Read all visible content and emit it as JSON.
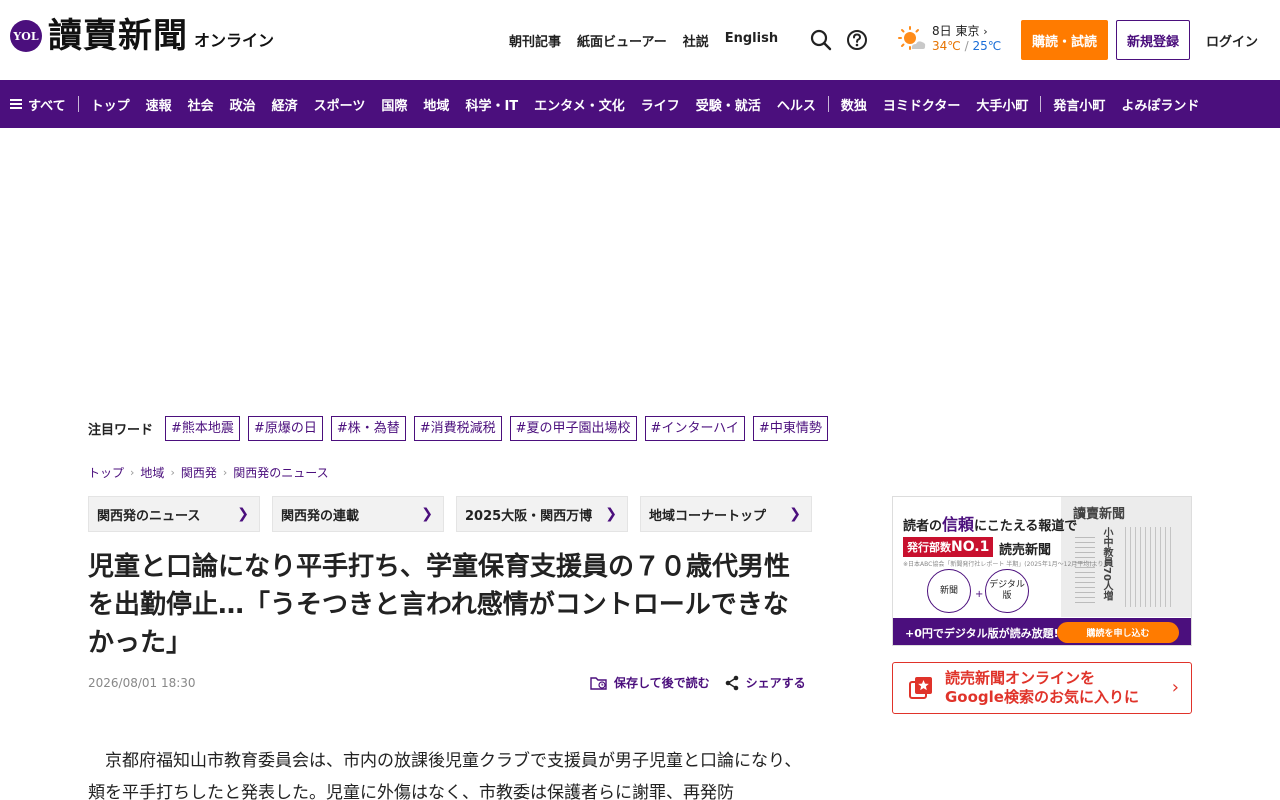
{
  "header": {
    "logo_badge": "YOL",
    "logo_text": "讀賣新聞",
    "logo_sub": "オンライン",
    "links": [
      "朝刊記事",
      "紙面ビューアー",
      "社説",
      "English"
    ],
    "weather": {
      "date_city": "8日 東京",
      "high": "34℃",
      "sep": "/",
      "low": "25℃"
    },
    "subscribe_label": "購読・試読",
    "register_label": "新規登録",
    "login_label": "ログイン"
  },
  "nav": {
    "all_label": "すべて",
    "group1": [
      "トップ",
      "速報",
      "社会",
      "政治",
      "経済",
      "スポーツ",
      "国際",
      "地域",
      "科学・IT",
      "エンタメ・文化",
      "ライフ",
      "受験・就活",
      "ヘルス"
    ],
    "group2": [
      "数独",
      "ヨミドクター",
      "大手小町"
    ],
    "group3": [
      "発言小町",
      "よみぽランド"
    ]
  },
  "trend": {
    "label": "注目ワード",
    "tags": [
      "#熊本地震",
      "#原爆の日",
      "#株・為替",
      "#消費税減税",
      "#夏の甲子園出場校",
      "#インターハイ",
      "#中東情勢"
    ]
  },
  "breadcrumb": [
    "トップ",
    "地域",
    "関西発",
    "関西発のニュース"
  ],
  "subnav": [
    "関西発のニュース",
    "関西発の連載",
    "2025大阪・関西万博",
    "地域コーナートップ"
  ],
  "article": {
    "headline": "児童と口論になり平手打ち、学童保育支援員の７０歳代男性を出勤停止…「うそつきと言われ感情がコントロールできなかった」",
    "date": "2026/08/01 18:30",
    "save_label": "保存して後で読む",
    "share_label": "シェアする",
    "body": "京都府福知山市教育委員会は、市内の放課後児童クラブで支援員が男子児童と口論になり、頬を平手打ちしたと発表した。児童に外傷はなく、市教委は保護者らに謝罪、再発防"
  },
  "ad": {
    "head_pre": "読者の",
    "head_strong": "信頼",
    "head_post": "にこたえる報道で",
    "badge_pre": "発行部数",
    "badge_no1": "NO.1",
    "name": "読売新聞",
    "note": "※日本ABC協会「新聞発行社レポート 半期」(2025年1月〜12月平均)より",
    "circle1": "新聞",
    "circle2": "デジタル版",
    "plus": "+",
    "paper_mast": "讀賣新聞",
    "paper_headline": "小中教員70人増",
    "bar_text": "+0円でデジタル版が読み放題!",
    "cta": "購読を申し込む"
  },
  "google_box": {
    "line1": "読売新聞オンラインを",
    "line2": "Google検索のお気に入りに"
  },
  "colors": {
    "brand_purple": "#4b0f7d",
    "accent_orange": "#ff7b00",
    "google_red": "#e0332a"
  }
}
